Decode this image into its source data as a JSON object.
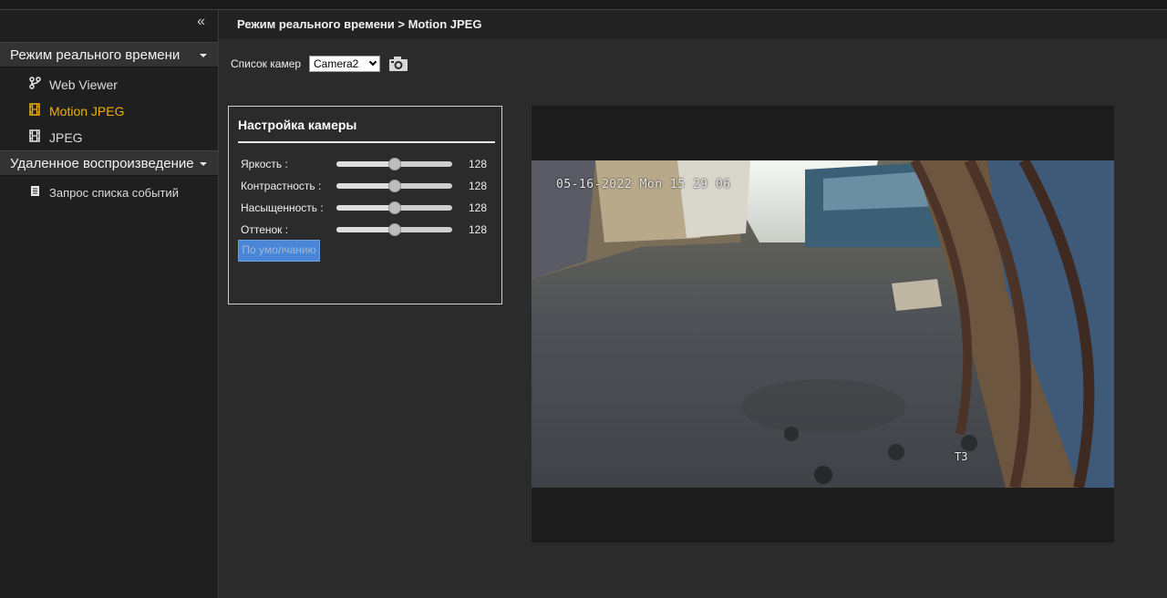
{
  "sidebar": {
    "collapse_icon": "«",
    "sections": [
      {
        "label": "Режим реального времени",
        "items": [
          {
            "icon": "branch-icon",
            "label": "Web Viewer"
          },
          {
            "icon": "film-icon",
            "label": "Motion JPEG"
          },
          {
            "icon": "film-icon",
            "label": "JPEG"
          }
        ]
      },
      {
        "label": "Удаленное воспроизведение",
        "items": [
          {
            "icon": "document-icon",
            "label": "Запрос списка событий"
          }
        ]
      }
    ],
    "active_item": "Motion JPEG"
  },
  "main": {
    "breadcrumb": "Режим реального времени > Motion JPEG",
    "camera_list_label": "Список камер",
    "camera_selected": "Camera2",
    "camera_settings": {
      "title": "Настройка камеры",
      "sliders": [
        {
          "label": "Яркость :",
          "value": "128",
          "level": 0.5
        },
        {
          "label": "Контрастность :",
          "value": "128",
          "level": 0.5
        },
        {
          "label": "Насыщенность :",
          "value": "128",
          "level": 0.5
        },
        {
          "label": "Оттенок :",
          "value": "128",
          "level": 0.5
        }
      ],
      "default_button": "По умолчанию"
    },
    "video": {
      "timestamp": "05-16-2022 Mon 15 29 06",
      "camera_tag": "T3"
    }
  },
  "colors": {
    "accent": "#f0b000",
    "button": "#4a86d8",
    "background": "#2b2b2b",
    "sidebar": "#1f1f1f"
  }
}
